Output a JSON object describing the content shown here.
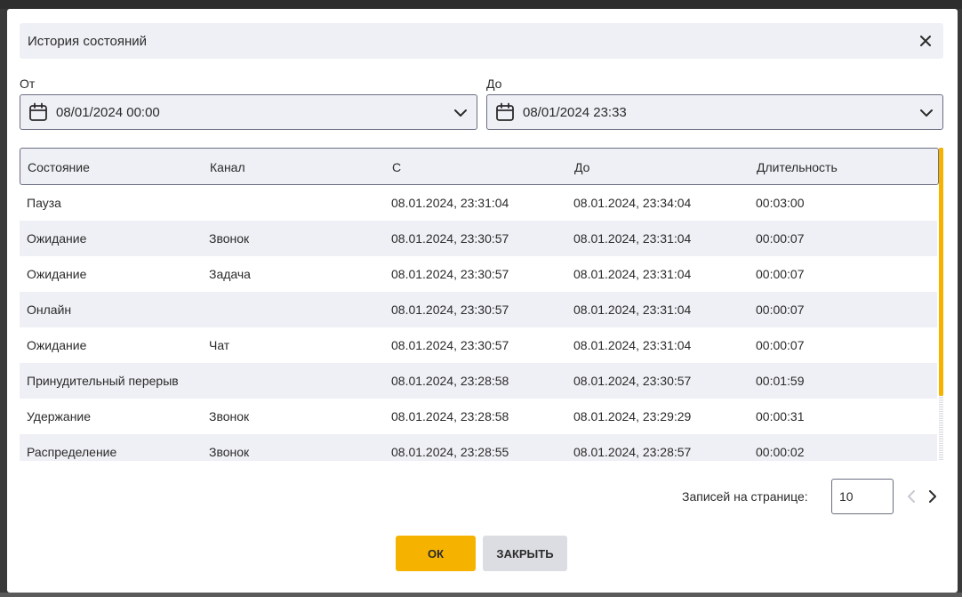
{
  "dialog": {
    "title": "История состояний"
  },
  "filters": {
    "from_label": "От",
    "from_value": "08/01/2024 00:00",
    "to_label": "До",
    "to_value": "08/01/2024 23:33"
  },
  "table": {
    "columns": [
      "Состояние",
      "Канал",
      "С",
      "До",
      "Длительность"
    ],
    "rows": [
      [
        "Пауза",
        "",
        "08.01.2024, 23:31:04",
        "08.01.2024, 23:34:04",
        "00:03:00"
      ],
      [
        "Ожидание",
        "Звонок",
        "08.01.2024, 23:30:57",
        "08.01.2024, 23:31:04",
        "00:00:07"
      ],
      [
        "Ожидание",
        "Задача",
        "08.01.2024, 23:30:57",
        "08.01.2024, 23:31:04",
        "00:00:07"
      ],
      [
        "Онлайн",
        "",
        "08.01.2024, 23:30:57",
        "08.01.2024, 23:31:04",
        "00:00:07"
      ],
      [
        "Ожидание",
        "Чат",
        "08.01.2024, 23:30:57",
        "08.01.2024, 23:31:04",
        "00:00:07"
      ],
      [
        "Принудительный перерыв",
        "",
        "08.01.2024, 23:28:58",
        "08.01.2024, 23:30:57",
        "00:01:59"
      ],
      [
        "Удержание",
        "Звонок",
        "08.01.2024, 23:28:58",
        "08.01.2024, 23:29:29",
        "00:00:31"
      ],
      [
        "Распределение",
        "Звонок",
        "08.01.2024, 23:28:55",
        "08.01.2024, 23:28:57",
        "00:00:02"
      ]
    ]
  },
  "pagination": {
    "per_page_label": "Записей на странице:",
    "per_page_value": "10"
  },
  "buttons": {
    "ok": "ОК",
    "close": "ЗАКРЫТЬ"
  },
  "colors": {
    "accent": "#f5b300",
    "panel": "#eff0f5",
    "border": "#6b6e82"
  }
}
